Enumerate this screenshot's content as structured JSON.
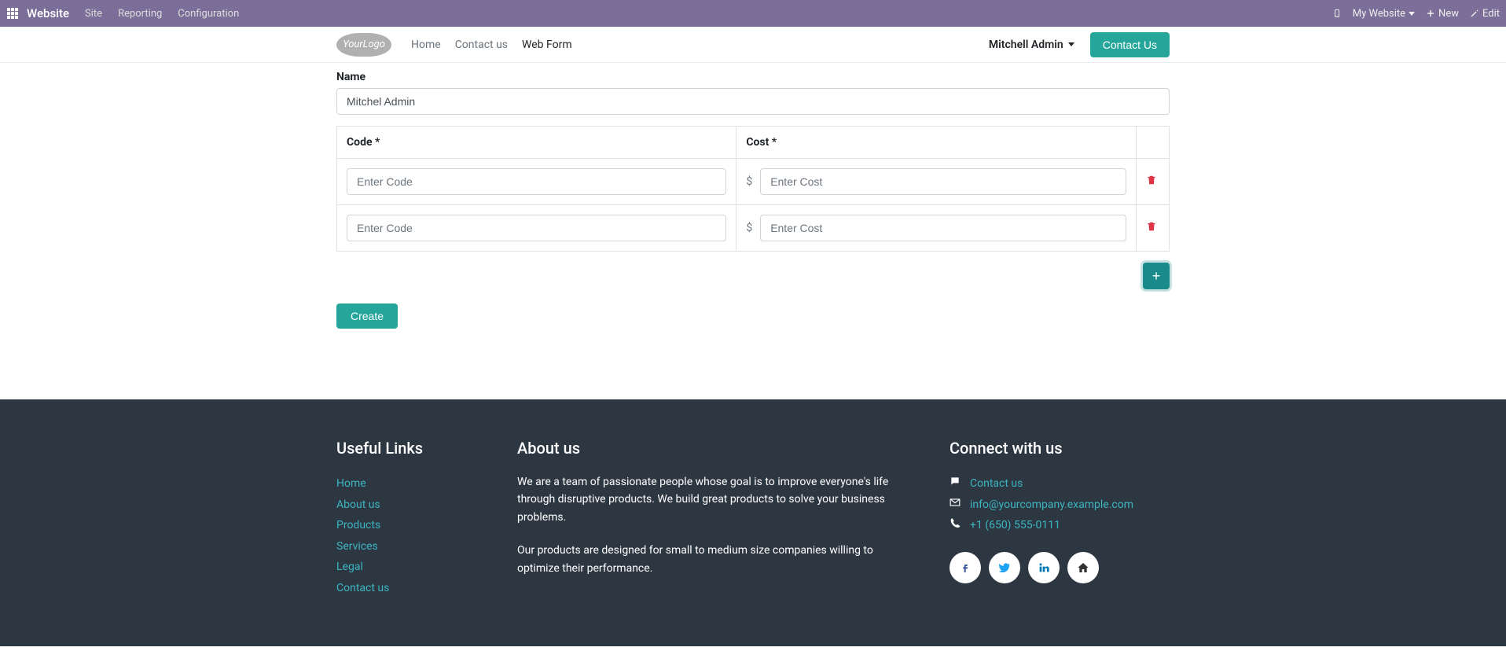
{
  "topbar": {
    "brand": "Website",
    "menu": [
      "Site",
      "Reporting",
      "Configuration"
    ],
    "my_website": "My Website",
    "new": "New",
    "edit": "Edit"
  },
  "sitebar": {
    "logo_text": "YourLogo",
    "nav": {
      "home": "Home",
      "contact_us": "Contact us",
      "web_form": "Web Form"
    },
    "user": "Mitchell Admin",
    "contact_btn": "Contact Us"
  },
  "form": {
    "name_label": "Name",
    "name_value": "Mitchel Admin",
    "code_header": "Code *",
    "cost_header": "Cost *",
    "code_placeholder": "Enter Code",
    "cost_placeholder": "Enter Cost",
    "currency_sym": "$",
    "rows": [
      {
        "code": "",
        "cost": ""
      },
      {
        "code": "",
        "cost": ""
      }
    ],
    "create_btn": "Create",
    "add_btn_glyph": "+"
  },
  "footer": {
    "useful_links": {
      "title": "Useful Links",
      "items": [
        "Home",
        "About us",
        "Products",
        "Services",
        "Legal",
        "Contact us"
      ]
    },
    "about": {
      "title": "About us",
      "p1": "We are a team of passionate people whose goal is to improve everyone's life through disruptive products. We build great products to solve your business problems.",
      "p2": "Our products are designed for small to medium size companies willing to optimize their performance."
    },
    "connect": {
      "title": "Connect with us",
      "contact": "Contact us",
      "email": "info@yourcompany.example.com",
      "phone": "+1 (650) 555-0111"
    }
  }
}
